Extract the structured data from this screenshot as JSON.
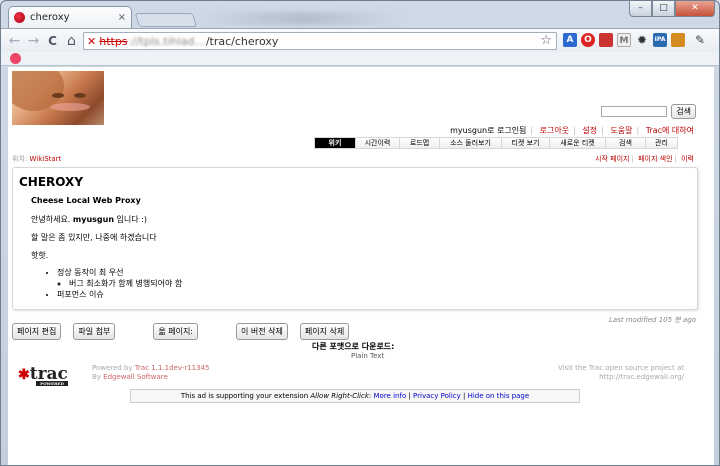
{
  "browser": {
    "tab_title": "cheroxy",
    "tab_close": "×",
    "window_controls": {
      "minimize": "–",
      "maximize": "□",
      "close": "✕"
    },
    "back": "←",
    "forward": "→",
    "reload": "C",
    "home": "⌂",
    "url_scheme": "https",
    "url_host": "://tpls.tihlad...",
    "url_path": "/trac/cheroxy",
    "star": "☆"
  },
  "extensions": [
    {
      "name": "translate-icon",
      "color": "#2a6ad1",
      "glyph": "A"
    },
    {
      "name": "opera-icon",
      "color": "#d22",
      "glyph": "O"
    },
    {
      "name": "bookmark-red-icon",
      "color": "#c33",
      "glyph": "▮"
    },
    {
      "name": "gmail-icon",
      "color": "#777",
      "glyph": "M"
    },
    {
      "name": "gear-icon",
      "color": "#333",
      "glyph": "✹"
    },
    {
      "name": "ipa-icon",
      "color": "#2b6cb0",
      "glyph": "IPA"
    },
    {
      "name": "puzzle-icon",
      "color": "#d48b1f",
      "glyph": "▦"
    },
    {
      "name": "wrench-icon",
      "color": "#444",
      "glyph": "✎"
    }
  ],
  "search": {
    "button": "검색"
  },
  "metanav": {
    "user": "myusgun로 로그인됨",
    "logout": "로그아웃",
    "prefs": "설정",
    "help": "도움말",
    "about": "Trac에 대하여"
  },
  "mainnav": [
    {
      "label": "위키",
      "active": true
    },
    {
      "label": "시간이력",
      "active": false
    },
    {
      "label": "로드맵",
      "active": false
    },
    {
      "label": "소스 둘러보기",
      "active": false
    },
    {
      "label": "티켓 보기",
      "active": false
    },
    {
      "label": "새로운 티켓",
      "active": false
    },
    {
      "label": "검색",
      "active": false
    },
    {
      "label": "관리",
      "active": false
    }
  ],
  "breadcrumb": {
    "prefix": "위치:",
    "page": "WikiStart"
  },
  "ctxnav": {
    "start": "시작 페이지",
    "index": "페이지 색인",
    "history": "이력"
  },
  "wiki": {
    "title": "CHEROXY",
    "subtitle": "Cheese Local Web Proxy",
    "greeting_pre": "안녕하세요. ",
    "greeting_user": "myusgun",
    "greeting_post": " 입니다 :)",
    "line2": "할 말은 좀 있지만, 나중에 하겠습니다",
    "line3": "핫핫.",
    "list": [
      "정상 동작이 최 우선",
      "버그 최소화가 함께 병행되어야 함",
      "퍼포먼스 이슈"
    ]
  },
  "lastmod": "Last modified 105 분 ago",
  "buttons": {
    "edit": "페이지 편집",
    "attach": "파일 첨부",
    "rename": "옮 페이지:",
    "delete_version": "이 버전 삭제",
    "delete_page": "페이지 삭제"
  },
  "altlinks": {
    "title": "다른 포맷으로 다운로드:",
    "plain": "Plain Text"
  },
  "footer": {
    "logo": "trac",
    "powered_label": "POWERED",
    "powered_by": "Powered by ",
    "trac_version": "Trac 1.1.1dev-r11345",
    "by": "By ",
    "edgewall": "Edgewall Software",
    "visit1": "Visit the Trac open source project at",
    "visit2": "http://trac.edgewall.org/"
  },
  "ad": {
    "text1": "This ad is supporting your extension ",
    "ext": "Allow Right-Click",
    "colon": ": ",
    "more": "More info",
    "sep": " | ",
    "privacy": "Privacy Policy",
    "hide": "Hide on this page"
  }
}
